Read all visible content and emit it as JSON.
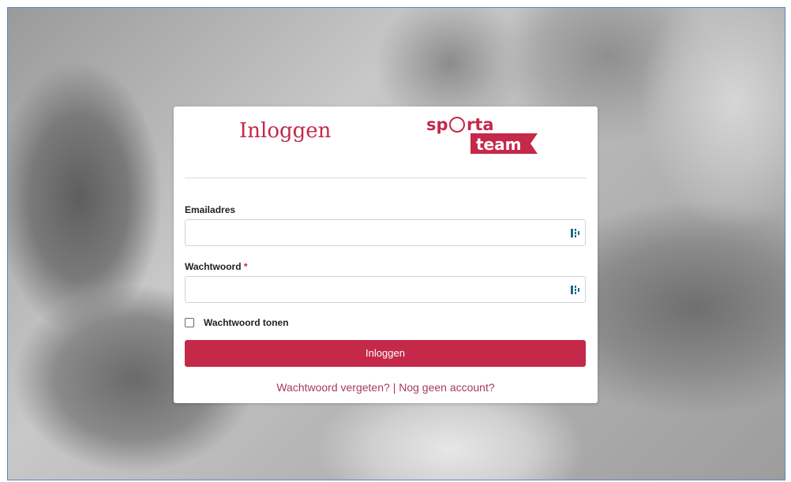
{
  "colors": {
    "accent": "#c4294a",
    "link": "#a83a56",
    "frame_border": "#5b86c4"
  },
  "login": {
    "title": "Inloggen",
    "logo": {
      "line1_left": "sp",
      "line1_right": "rta",
      "line2": "team"
    },
    "email": {
      "label": "Emailadres",
      "value": "",
      "placeholder": ""
    },
    "password": {
      "label": "Wachtwoord",
      "required_marker": "*",
      "value": "",
      "placeholder": ""
    },
    "show_password": {
      "label": "Wachtwoord tonen",
      "checked": false
    },
    "submit_label": "Inloggen",
    "links": {
      "forgot": "Wachtwoord vergeten?",
      "separator": "|",
      "register": "Nog geen account?"
    }
  },
  "icons": {
    "field_helper": "password-manager-icon",
    "checkbox": "checkbox-icon"
  }
}
